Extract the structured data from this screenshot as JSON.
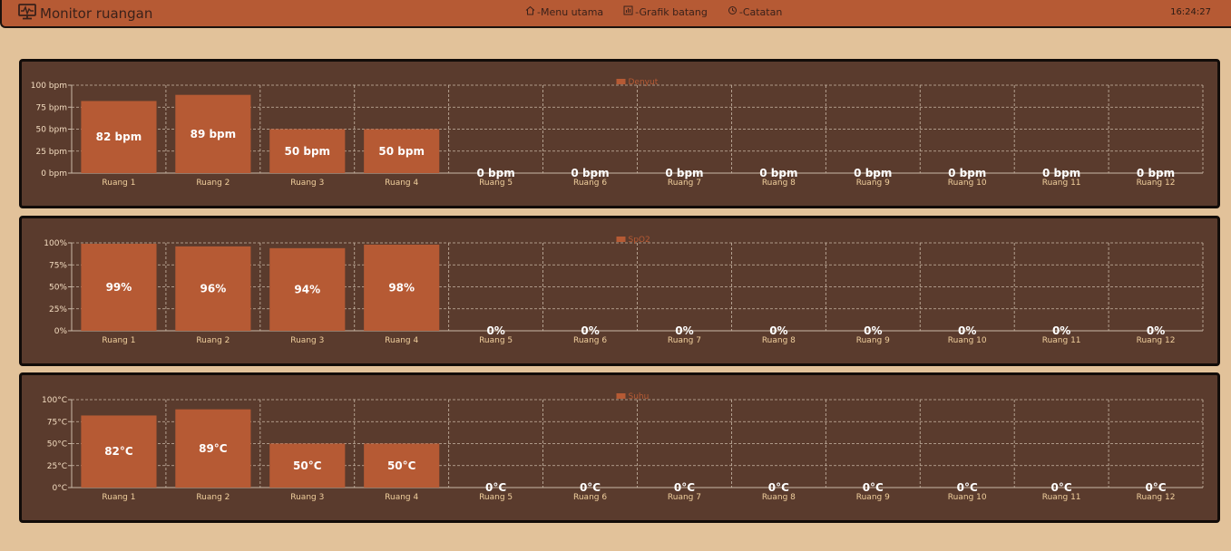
{
  "header": {
    "title": "Monitor ruangan",
    "nav": [
      {
        "label": "-Menu utama",
        "icon": "home-icon"
      },
      {
        "label": "-Grafik batang",
        "icon": "bar-chart-icon"
      },
      {
        "label": "-Catatan",
        "icon": "history-icon"
      }
    ],
    "time": "16:24:27"
  },
  "colors": {
    "bar": "#b65a34",
    "panel": "#5a3b2d",
    "background": "#e2c29a"
  },
  "chart_data": [
    {
      "type": "bar",
      "legend": "Denyut",
      "categories": [
        "Ruang 1",
        "Ruang 2",
        "Ruang 3",
        "Ruang 4",
        "Ruang 5",
        "Ruang 6",
        "Ruang 7",
        "Ruang 8",
        "Ruang 9",
        "Ruang 10",
        "Ruang 11",
        "Ruang 12"
      ],
      "values": [
        82,
        89,
        50,
        50,
        0,
        0,
        0,
        0,
        0,
        0,
        0,
        0
      ],
      "unit": " bpm",
      "ylim": [
        0,
        100
      ],
      "yticks": [
        "0 bpm",
        "25 bpm",
        "50 bpm",
        "75 bpm",
        "100 bpm"
      ],
      "grid": true,
      "legend_position": "top-center"
    },
    {
      "type": "bar",
      "legend": "SpO2",
      "categories": [
        "Ruang 1",
        "Ruang 2",
        "Ruang 3",
        "Ruang 4",
        "Ruang 5",
        "Ruang 6",
        "Ruang 7",
        "Ruang 8",
        "Ruang 9",
        "Ruang 10",
        "Ruang 11",
        "Ruang 12"
      ],
      "values": [
        99,
        96,
        94,
        98,
        0,
        0,
        0,
        0,
        0,
        0,
        0,
        0
      ],
      "unit": "%",
      "ylim": [
        0,
        100
      ],
      "yticks": [
        "0%",
        "25%",
        "50%",
        "75%",
        "100%"
      ],
      "grid": true,
      "legend_position": "top-center"
    },
    {
      "type": "bar",
      "legend": "Suhu",
      "categories": [
        "Ruang 1",
        "Ruang 2",
        "Ruang 3",
        "Ruang 4",
        "Ruang 5",
        "Ruang 6",
        "Ruang 7",
        "Ruang 8",
        "Ruang 9",
        "Ruang 10",
        "Ruang 11",
        "Ruang 12"
      ],
      "values": [
        82,
        89,
        50,
        50,
        0,
        0,
        0,
        0,
        0,
        0,
        0,
        0
      ],
      "unit": "°C",
      "ylim": [
        0,
        100
      ],
      "yticks": [
        "0°C",
        "25°C",
        "50°C",
        "75°C",
        "100°C"
      ],
      "grid": true,
      "legend_position": "top-center"
    }
  ]
}
